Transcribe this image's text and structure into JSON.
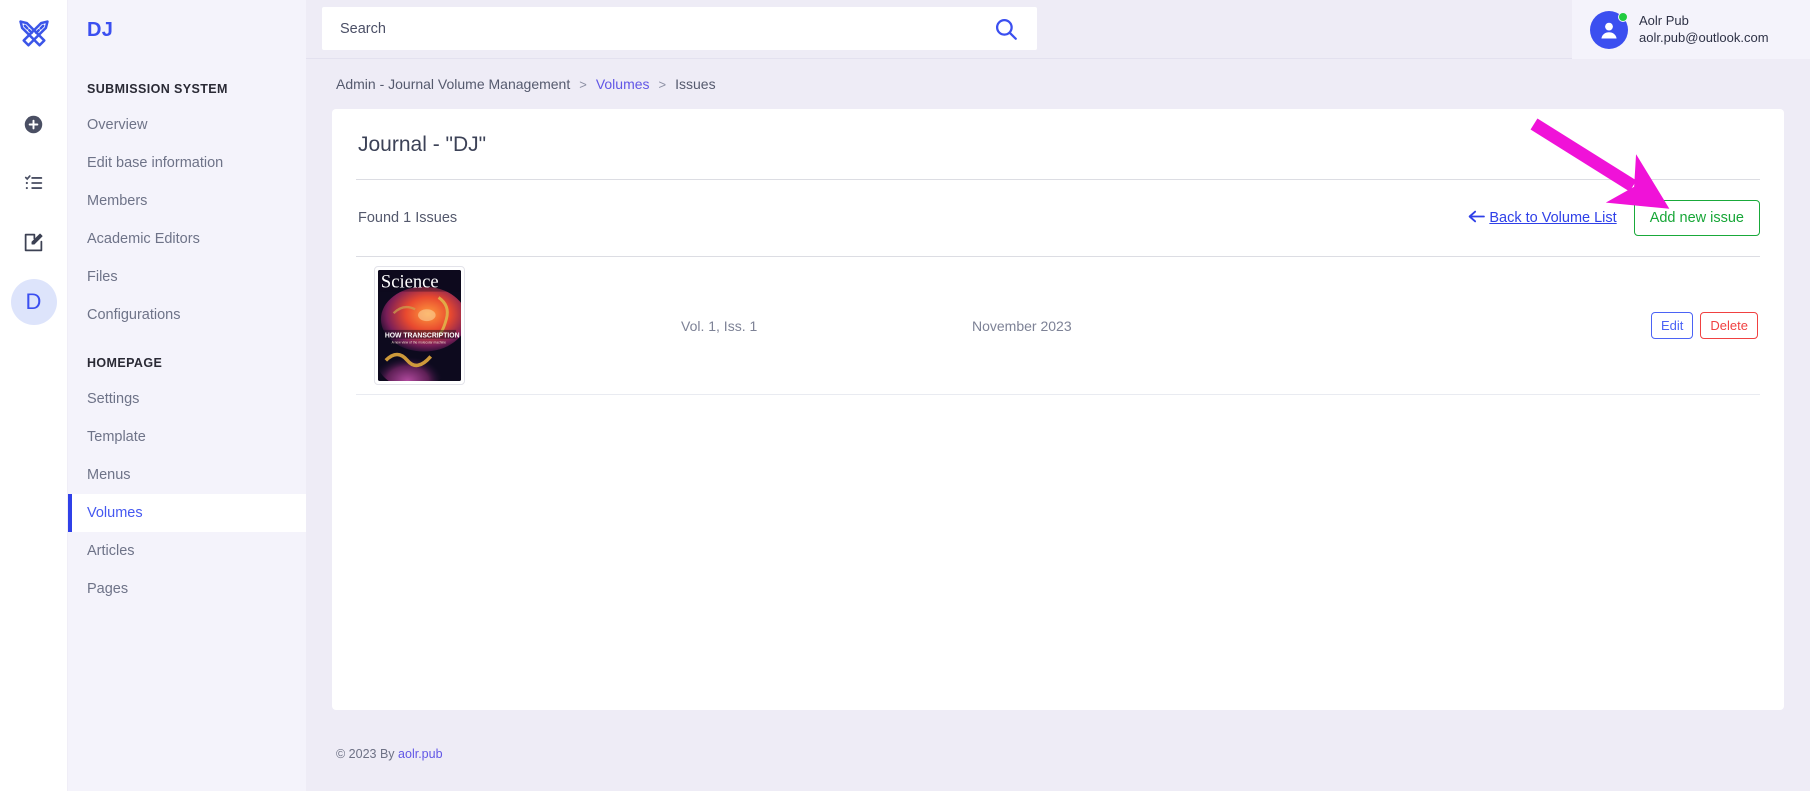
{
  "rail": {
    "logo_icon": "crossed-pencil-ruler-icon",
    "icons": [
      {
        "name": "add-circle-icon"
      },
      {
        "name": "checklist-icon"
      },
      {
        "name": "edit-square-icon"
      }
    ],
    "avatar_initial": "D"
  },
  "sidebar": {
    "brand": "DJ",
    "groups": [
      {
        "title": "SUBMISSION SYSTEM",
        "items": [
          {
            "label": "Overview",
            "active": false
          },
          {
            "label": "Edit base information",
            "active": false
          },
          {
            "label": "Members",
            "active": false
          },
          {
            "label": "Academic Editors",
            "active": false
          },
          {
            "label": "Files",
            "active": false
          },
          {
            "label": "Configurations",
            "active": false
          }
        ]
      },
      {
        "title": "HOMEPAGE",
        "items": [
          {
            "label": "Settings",
            "active": false
          },
          {
            "label": "Template",
            "active": false
          },
          {
            "label": "Menus",
            "active": false
          },
          {
            "label": "Volumes",
            "active": true
          },
          {
            "label": "Articles",
            "active": false
          },
          {
            "label": "Pages",
            "active": false
          }
        ]
      }
    ]
  },
  "topbar": {
    "search_placeholder": "Search",
    "search_value": "",
    "search_icon": "search-icon",
    "user": {
      "name": "Aolr Pub",
      "email": "aolr.pub@outlook.com",
      "status": "online"
    }
  },
  "breadcrumb": [
    {
      "label": "Admin - Journal Volume Management",
      "link": false
    },
    {
      "label": "Volumes",
      "link": true
    },
    {
      "label": "Issues",
      "link": false
    }
  ],
  "breadcrumb_separator": ">",
  "card": {
    "title": "Journal - \"DJ\"",
    "found_text": "Found 1 Issues",
    "back_link": "Back to Volume List",
    "back_icon": "arrow-left-icon",
    "add_button": "Add new issue"
  },
  "issues": [
    {
      "cover_title": "Science",
      "cover_headline": "HOW TRANSCRIPTION BEGINS",
      "volume_issue": "Vol. 1, Iss. 1",
      "date": "November 2023",
      "edit_label": "Edit",
      "delete_label": "Delete"
    }
  ],
  "footer": {
    "copyright": "© 2023 By",
    "link": "aolr.pub"
  },
  "colors": {
    "accent": "#3b4ff0",
    "page_bg": "#eeecf6",
    "sidebar_bg": "#f4f3fb",
    "success": "#17a637",
    "danger": "#f04141",
    "annotation_arrow": "#f012d8"
  },
  "annotation": {
    "arrow_name": "pink-pointer-arrow",
    "points_to": "Add new issue"
  }
}
